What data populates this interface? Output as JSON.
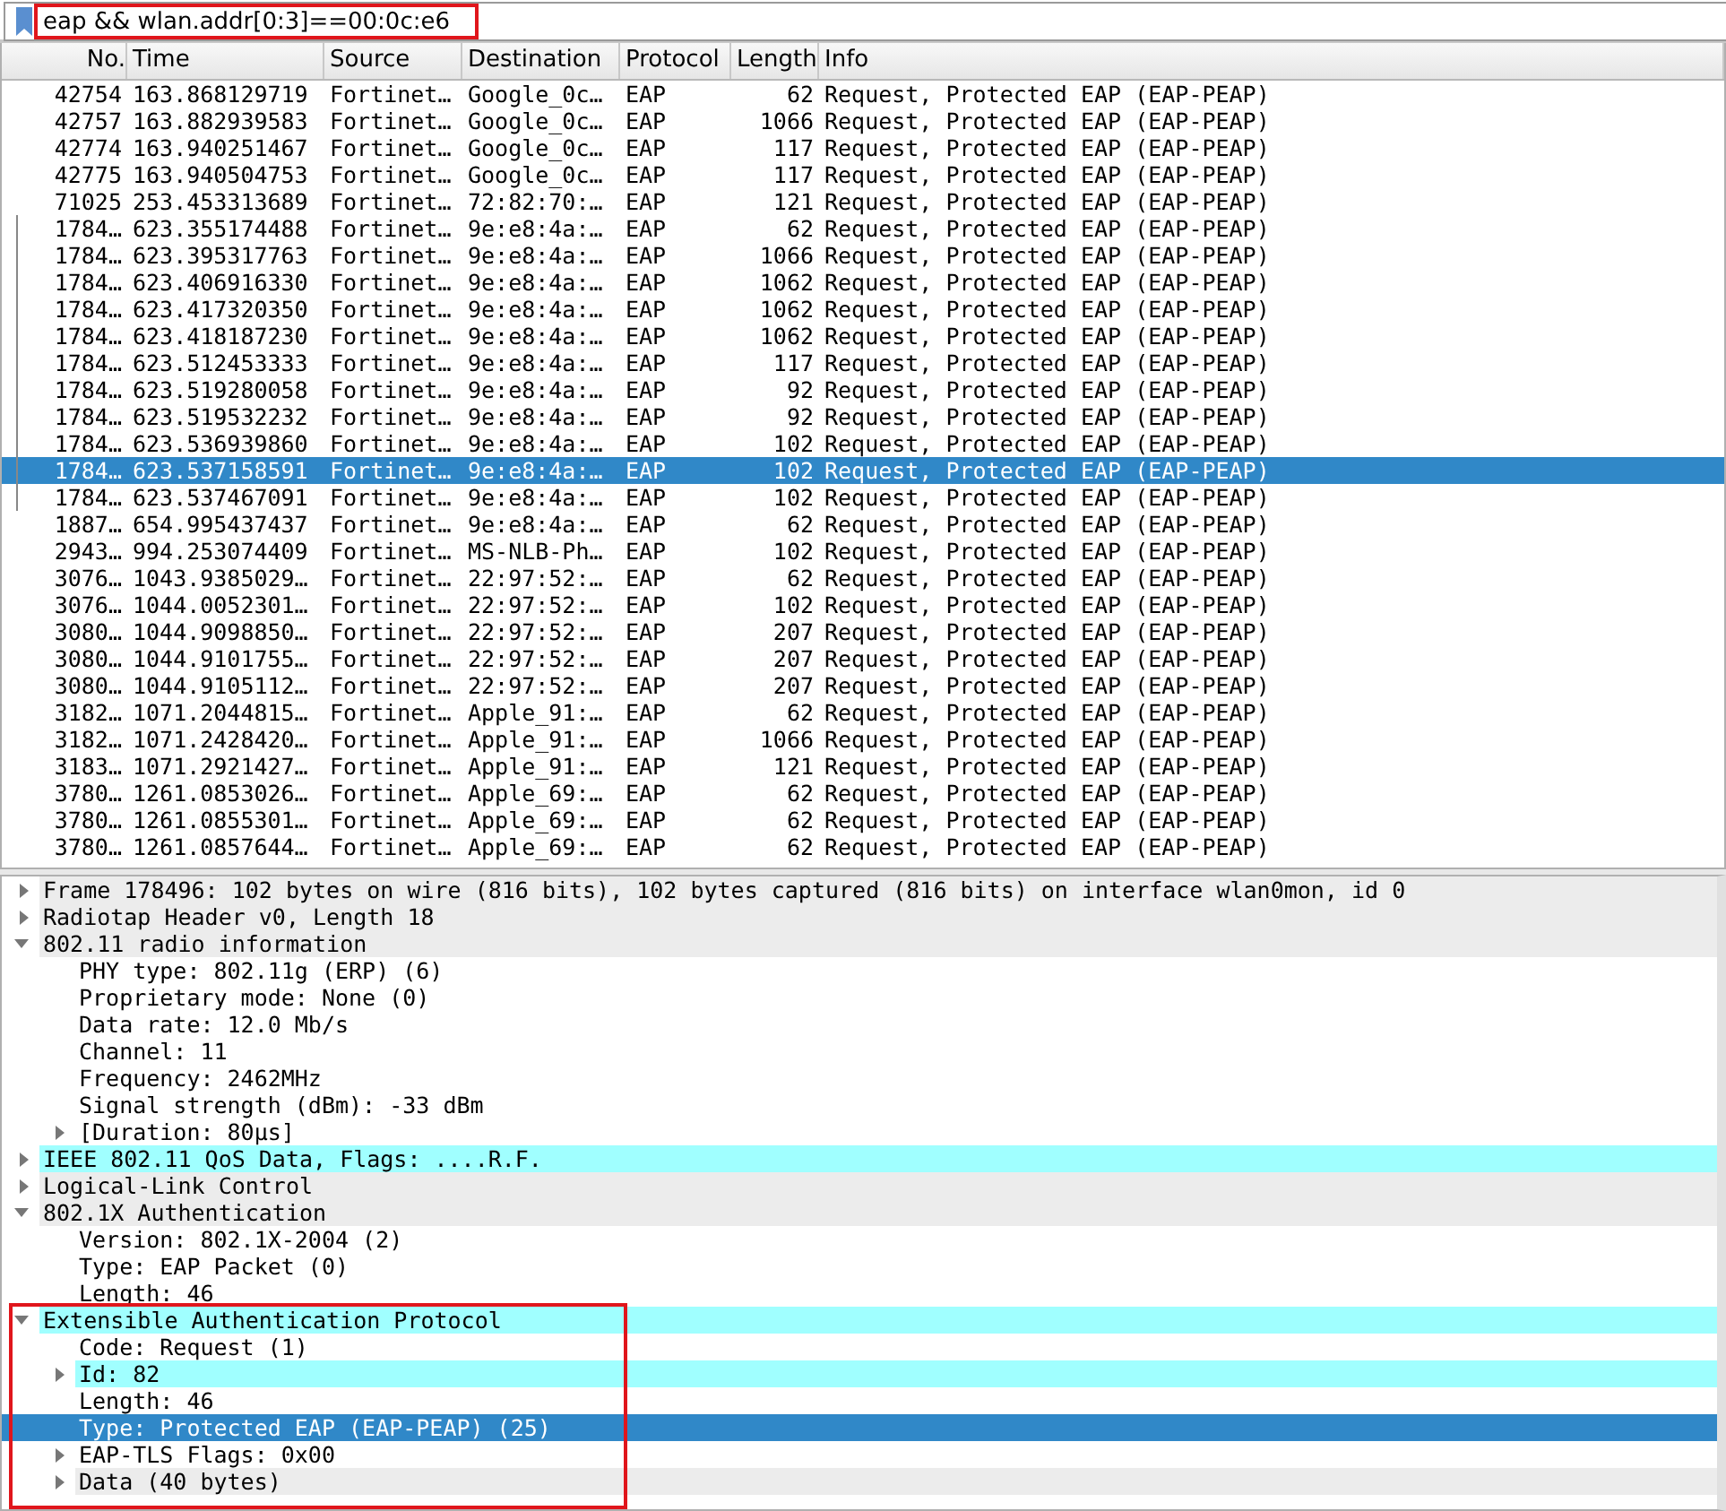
{
  "filter": {
    "value": "eap && wlan.addr[0:3]==00:0c:e6",
    "annotated": true
  },
  "packet_list": {
    "columns": [
      "No.",
      "Time",
      "Source",
      "Destination",
      "Protocol",
      "Length",
      "Info"
    ],
    "rows": [
      {
        "no": "42754",
        "time": "163.868129719",
        "source": "Fortinet…",
        "destination": "Google_0c…",
        "protocol": "EAP",
        "length": "62",
        "info": "Request, Protected EAP (EAP-PEAP)",
        "related": false,
        "selected": false
      },
      {
        "no": "42757",
        "time": "163.882939583",
        "source": "Fortinet…",
        "destination": "Google_0c…",
        "protocol": "EAP",
        "length": "1066",
        "info": "Request, Protected EAP (EAP-PEAP)",
        "related": false,
        "selected": false
      },
      {
        "no": "42774",
        "time": "163.940251467",
        "source": "Fortinet…",
        "destination": "Google_0c…",
        "protocol": "EAP",
        "length": "117",
        "info": "Request, Protected EAP (EAP-PEAP)",
        "related": false,
        "selected": false
      },
      {
        "no": "42775",
        "time": "163.940504753",
        "source": "Fortinet…",
        "destination": "Google_0c…",
        "protocol": "EAP",
        "length": "117",
        "info": "Request, Protected EAP (EAP-PEAP)",
        "related": false,
        "selected": false
      },
      {
        "no": "71025",
        "time": "253.453313689",
        "source": "Fortinet…",
        "destination": "72:82:70:…",
        "protocol": "EAP",
        "length": "121",
        "info": "Request, Protected EAP (EAP-PEAP)",
        "related": false,
        "selected": false
      },
      {
        "no": "1784…",
        "time": "623.355174488",
        "source": "Fortinet…",
        "destination": "9e:e8:4a:…",
        "protocol": "EAP",
        "length": "62",
        "info": "Request, Protected EAP (EAP-PEAP)",
        "related": true,
        "selected": false
      },
      {
        "no": "1784…",
        "time": "623.395317763",
        "source": "Fortinet…",
        "destination": "9e:e8:4a:…",
        "protocol": "EAP",
        "length": "1066",
        "info": "Request, Protected EAP (EAP-PEAP)",
        "related": true,
        "selected": false
      },
      {
        "no": "1784…",
        "time": "623.406916330",
        "source": "Fortinet…",
        "destination": "9e:e8:4a:…",
        "protocol": "EAP",
        "length": "1062",
        "info": "Request, Protected EAP (EAP-PEAP)",
        "related": true,
        "selected": false
      },
      {
        "no": "1784…",
        "time": "623.417320350",
        "source": "Fortinet…",
        "destination": "9e:e8:4a:…",
        "protocol": "EAP",
        "length": "1062",
        "info": "Request, Protected EAP (EAP-PEAP)",
        "related": true,
        "selected": false
      },
      {
        "no": "1784…",
        "time": "623.418187230",
        "source": "Fortinet…",
        "destination": "9e:e8:4a:…",
        "protocol": "EAP",
        "length": "1062",
        "info": "Request, Protected EAP (EAP-PEAP)",
        "related": true,
        "selected": false
      },
      {
        "no": "1784…",
        "time": "623.512453333",
        "source": "Fortinet…",
        "destination": "9e:e8:4a:…",
        "protocol": "EAP",
        "length": "117",
        "info": "Request, Protected EAP (EAP-PEAP)",
        "related": true,
        "selected": false
      },
      {
        "no": "1784…",
        "time": "623.519280058",
        "source": "Fortinet…",
        "destination": "9e:e8:4a:…",
        "protocol": "EAP",
        "length": "92",
        "info": "Request, Protected EAP (EAP-PEAP)",
        "related": true,
        "selected": false
      },
      {
        "no": "1784…",
        "time": "623.519532232",
        "source": "Fortinet…",
        "destination": "9e:e8:4a:…",
        "protocol": "EAP",
        "length": "92",
        "info": "Request, Protected EAP (EAP-PEAP)",
        "related": true,
        "selected": false
      },
      {
        "no": "1784…",
        "time": "623.536939860",
        "source": "Fortinet…",
        "destination": "9e:e8:4a:…",
        "protocol": "EAP",
        "length": "102",
        "info": "Request, Protected EAP (EAP-PEAP)",
        "related": true,
        "selected": false
      },
      {
        "no": "1784…",
        "time": "623.537158591",
        "source": "Fortinet…",
        "destination": "9e:e8:4a:…",
        "protocol": "EAP",
        "length": "102",
        "info": "Request, Protected EAP (EAP-PEAP)",
        "related": true,
        "selected": true
      },
      {
        "no": "1784…",
        "time": "623.537467091",
        "source": "Fortinet…",
        "destination": "9e:e8:4a:…",
        "protocol": "EAP",
        "length": "102",
        "info": "Request, Protected EAP (EAP-PEAP)",
        "related": true,
        "selected": false
      },
      {
        "no": "1887…",
        "time": "654.995437437",
        "source": "Fortinet…",
        "destination": "9e:e8:4a:…",
        "protocol": "EAP",
        "length": "62",
        "info": "Request, Protected EAP (EAP-PEAP)",
        "related": false,
        "selected": false
      },
      {
        "no": "2943…",
        "time": "994.253074409",
        "source": "Fortinet…",
        "destination": "MS-NLB-Ph…",
        "protocol": "EAP",
        "length": "102",
        "info": "Request, Protected EAP (EAP-PEAP)",
        "related": false,
        "selected": false
      },
      {
        "no": "3076…",
        "time": "1043.9385029…",
        "source": "Fortinet…",
        "destination": "22:97:52:…",
        "protocol": "EAP",
        "length": "62",
        "info": "Request, Protected EAP (EAP-PEAP)",
        "related": false,
        "selected": false
      },
      {
        "no": "3076…",
        "time": "1044.0052301…",
        "source": "Fortinet…",
        "destination": "22:97:52:…",
        "protocol": "EAP",
        "length": "102",
        "info": "Request, Protected EAP (EAP-PEAP)",
        "related": false,
        "selected": false
      },
      {
        "no": "3080…",
        "time": "1044.9098850…",
        "source": "Fortinet…",
        "destination": "22:97:52:…",
        "protocol": "EAP",
        "length": "207",
        "info": "Request, Protected EAP (EAP-PEAP)",
        "related": false,
        "selected": false
      },
      {
        "no": "3080…",
        "time": "1044.9101755…",
        "source": "Fortinet…",
        "destination": "22:97:52:…",
        "protocol": "EAP",
        "length": "207",
        "info": "Request, Protected EAP (EAP-PEAP)",
        "related": false,
        "selected": false
      },
      {
        "no": "3080…",
        "time": "1044.9105112…",
        "source": "Fortinet…",
        "destination": "22:97:52:…",
        "protocol": "EAP",
        "length": "207",
        "info": "Request, Protected EAP (EAP-PEAP)",
        "related": false,
        "selected": false
      },
      {
        "no": "3182…",
        "time": "1071.2044815…",
        "source": "Fortinet…",
        "destination": "Apple_91:…",
        "protocol": "EAP",
        "length": "62",
        "info": "Request, Protected EAP (EAP-PEAP)",
        "related": false,
        "selected": false
      },
      {
        "no": "3182…",
        "time": "1071.2428420…",
        "source": "Fortinet…",
        "destination": "Apple_91:…",
        "protocol": "EAP",
        "length": "1066",
        "info": "Request, Protected EAP (EAP-PEAP)",
        "related": false,
        "selected": false
      },
      {
        "no": "3183…",
        "time": "1071.2921427…",
        "source": "Fortinet…",
        "destination": "Apple_91:…",
        "protocol": "EAP",
        "length": "121",
        "info": "Request, Protected EAP (EAP-PEAP)",
        "related": false,
        "selected": false
      },
      {
        "no": "3780…",
        "time": "1261.0853026…",
        "source": "Fortinet…",
        "destination": "Apple_69:…",
        "protocol": "EAP",
        "length": "62",
        "info": "Request, Protected EAP (EAP-PEAP)",
        "related": false,
        "selected": false
      },
      {
        "no": "3780…",
        "time": "1261.0855301…",
        "source": "Fortinet…",
        "destination": "Apple_69:…",
        "protocol": "EAP",
        "length": "62",
        "info": "Request, Protected EAP (EAP-PEAP)",
        "related": false,
        "selected": false
      },
      {
        "no": "3780…",
        "time": "1261.0857644…",
        "source": "Fortinet…",
        "destination": "Apple_69:…",
        "protocol": "EAP",
        "length": "62",
        "info": "Request, Protected EAP (EAP-PEAP)",
        "related": false,
        "selected": false
      }
    ]
  },
  "packet_details": [
    {
      "label": "Frame 178496: 102 bytes on wire (816 bits), 102 bytes captured (816 bits) on interface wlan0mon, id 0",
      "expanded": false,
      "color": "#ececec",
      "selected": false
    },
    {
      "label": "Radiotap Header v0, Length 18",
      "expanded": false,
      "color": "#ececec",
      "selected": false
    },
    {
      "label": "802.11 radio information",
      "expanded": true,
      "color": "#ececec",
      "selected": false,
      "children": [
        {
          "label": "PHY type: 802.11g (ERP) (6)",
          "selected": false
        },
        {
          "label": "Proprietary mode: None (0)",
          "selected": false
        },
        {
          "label": "Data rate: 12.0 Mb/s",
          "selected": false
        },
        {
          "label": "Channel: 11",
          "selected": false
        },
        {
          "label": "Frequency: 2462MHz",
          "selected": false
        },
        {
          "label": "Signal strength (dBm): -33 dBm",
          "selected": false
        },
        {
          "label": "[Duration: 80µs]",
          "expanded": false,
          "selected": false
        }
      ]
    },
    {
      "label": "IEEE 802.11 QoS Data, Flags: ....R.F.",
      "expanded": false,
      "color": "#a0ffff",
      "selected": false
    },
    {
      "label": "Logical-Link Control",
      "expanded": false,
      "color": "#ececec",
      "selected": false
    },
    {
      "label": "802.1X Authentication",
      "expanded": true,
      "color": "#ececec",
      "selected": false,
      "children": [
        {
          "label": "Version: 802.1X-2004 (2)",
          "selected": false
        },
        {
          "label": "Type: EAP Packet (0)",
          "selected": false
        },
        {
          "label": "Length: 46",
          "selected": false
        }
      ]
    },
    {
      "label": "Extensible Authentication Protocol",
      "expanded": true,
      "color": "#a0ffff",
      "selected": false,
      "annotated": true,
      "children": [
        {
          "label": "Code: Request (1)",
          "selected": false
        },
        {
          "label": "Id: 82",
          "expanded": false,
          "color": "#a0ffff",
          "selected": false
        },
        {
          "label": "Length: 46",
          "selected": false
        },
        {
          "label": "Type: Protected EAP (EAP-PEAP) (25)",
          "selected": true
        },
        {
          "label": "EAP-TLS Flags: 0x00",
          "expanded": false,
          "selected": false
        },
        {
          "label": "Data (40 bytes)",
          "expanded": false,
          "color": "#ececec",
          "selected": false
        }
      ]
    }
  ]
}
